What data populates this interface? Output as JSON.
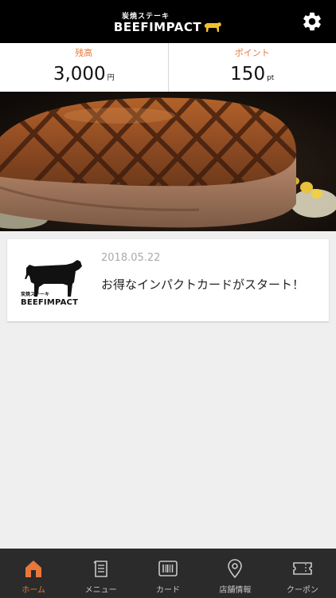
{
  "header": {
    "logo_sub": "炭焼ステーキ",
    "logo_main": "BEEFIMPACT"
  },
  "balance": {
    "cash_label": "残高",
    "cash_value": "3,000",
    "cash_unit": "円",
    "points_label": "ポイント",
    "points_value": "150",
    "points_unit": "pt"
  },
  "news": [
    {
      "logo_sub": "炭焼ステーキ",
      "logo_main": "BEEFIMPACT",
      "date": "2018.05.22",
      "title": "お得なインパクトカードがスタート！"
    }
  ],
  "tabs": [
    {
      "label": "ホーム",
      "icon": "home-icon",
      "active": true
    },
    {
      "label": "メニュー",
      "icon": "menu-book-icon",
      "active": false
    },
    {
      "label": "カード",
      "icon": "barcode-card-icon",
      "active": false
    },
    {
      "label": "店舗情報",
      "icon": "map-pin-icon",
      "active": false
    },
    {
      "label": "クーポン",
      "icon": "coupon-icon",
      "active": false
    }
  ],
  "colors": {
    "accent": "#e8773a",
    "header_bg": "#000000",
    "tabbar_bg": "#2b2b2b",
    "page_bg": "#efefef"
  }
}
